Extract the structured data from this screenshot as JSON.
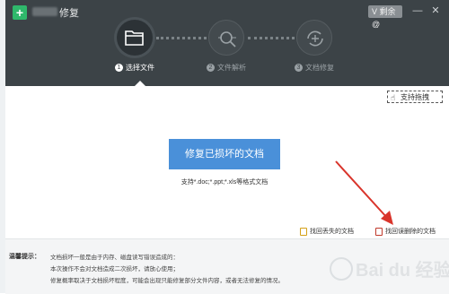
{
  "title_bar": {
    "app_title": "修复",
    "vip_badge": "V  剩余@"
  },
  "window_controls": {
    "minimize": "—",
    "close": "✕"
  },
  "steps": [
    {
      "num": "1",
      "label": "选择文件"
    },
    {
      "num": "2",
      "label": "文件解析"
    },
    {
      "num": "3",
      "label": "文档修复"
    }
  ],
  "toolbar": {
    "drag_support": "支持拖拽"
  },
  "main": {
    "repair_button": "修复已损坏的文档",
    "support_text": "支持*.doc;*.ppt;*.xls等格式文档"
  },
  "links": {
    "recover_lost": "找回丢失的文档",
    "recover_deleted": "找回误删除的文档"
  },
  "tips": {
    "label": "温馨提示：",
    "lines": [
      "文档损坏一般是由于内存、磁盘读写错误造成的：",
      "本次操作不会对文档造成二次损坏，请放心使用；",
      "修复概率取决于文档损坏程度，可能会出现只能修复部分文件内容，或者无法修复的情况。"
    ]
  },
  "watermark": {
    "text": "Bai du 经验"
  },
  "colors": {
    "titlebar": "#3c4347",
    "accent_blue": "#4a90d9",
    "arrow_red": "#d9342b"
  }
}
